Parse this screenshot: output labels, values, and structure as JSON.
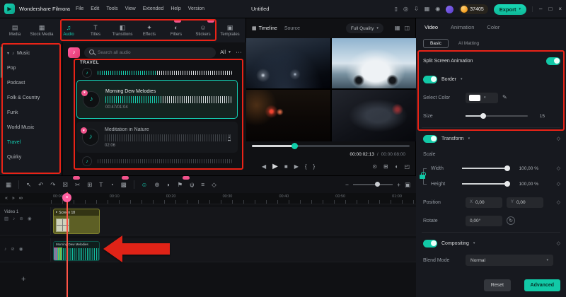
{
  "topbar": {
    "brand": "Wondershare Filmora",
    "menus": [
      "File",
      "Edit",
      "Tools",
      "View",
      "Extended",
      "Help",
      "Version"
    ],
    "project_title": "Untitled",
    "coin_count": "37405",
    "export_label": "Export"
  },
  "media_tabs": [
    {
      "label": "Media",
      "icon": "▤"
    },
    {
      "label": "Stock Media",
      "icon": "▦"
    },
    {
      "label": "Audio",
      "icon": "♫"
    },
    {
      "label": "Titles",
      "icon": "T"
    },
    {
      "label": "Transitions",
      "icon": "◧"
    },
    {
      "label": "Effects",
      "icon": "✦"
    },
    {
      "label": "Filters",
      "icon": "◐"
    },
    {
      "label": "Stickers",
      "icon": "☺"
    },
    {
      "label": "Templates",
      "icon": "▣"
    }
  ],
  "sidebar": {
    "items": [
      "Music",
      "Pop",
      "Podcast",
      "Folk & Country",
      "Funk",
      "World Music",
      "Travel",
      "Quirky"
    ]
  },
  "audio_panel": {
    "search_placeholder": "Search all audio",
    "filter_label": "All",
    "section_title": "TRAVEL",
    "items": [
      {
        "title": "Morning Dew Melodies",
        "time": "00:47/01:04"
      },
      {
        "title": "Meditation in Nature",
        "time": "02:06"
      }
    ]
  },
  "preview": {
    "tab_timeline": "Timeline",
    "tab_source": "Source",
    "quality_label": "Full Quality",
    "timecode_current": "00:00:02:13",
    "timecode_separator": "/",
    "timecode_total": "00:00:08:00"
  },
  "properties": {
    "tab_video": "Video",
    "tab_animation": "Animation",
    "tab_color": "Color",
    "subtab_basic": "Basic",
    "subtab_ai": "AI Matting",
    "split_screen_label": "Split Screen Animation",
    "border_label": "Border",
    "select_color_label": "Select Color",
    "size_label": "Size",
    "size_value": "15",
    "transform_label": "Transform",
    "scale_label": "Scale",
    "width_label": "Width",
    "width_value": "100,00 %",
    "height_label": "Height",
    "height_value": "100,00 %",
    "position_label": "Position",
    "position_x_prefix": "X",
    "position_x_value": "0,00",
    "position_y_prefix": "Y",
    "position_y_value": "0,00",
    "rotate_label": "Rotate",
    "rotate_value": "0,00°",
    "compositing_label": "Compositing",
    "blend_mode_label": "Blend Mode",
    "blend_mode_value": "Normal",
    "reset_label": "Reset",
    "advanced_label": "Advanced"
  },
  "timeline": {
    "ruler_labels": [
      "00:00",
      "00:10",
      "00:20",
      "00:30",
      "00:40",
      "00:50",
      "01:00"
    ],
    "video_track_label": "Video 1",
    "video_clip_label": "Screen 18",
    "audio_clip_label": "Morning Dew Melodies",
    "add_track_label": "+"
  },
  "icons": {
    "logo": "▶",
    "phone": "▯",
    "bell": "◎",
    "import": "⇩",
    "workspace": "▦",
    "record": "◉",
    "caret_down": "▾",
    "minimize": "–",
    "maximize": "□",
    "close": "×",
    "music_note": "♪",
    "heart": "♥",
    "filter": "▼",
    "more": "⋯",
    "download": "↓",
    "timeline_tab": "▦",
    "grid_view": "▦",
    "split_view": "◫",
    "skip_back": "◀",
    "play": "▶",
    "stop": "■",
    "skip_forward": "▶",
    "mark_in": "{",
    "mark_out": "}",
    "snapshot": "⊙",
    "crop": "⊞",
    "speaker": "◖",
    "fullscreen": "◰",
    "layout": "▦",
    "pointer": "↖",
    "undo": "↶",
    "redo": "↷",
    "delete": "☒",
    "split": "✂",
    "text": "T",
    "speed": "◔",
    "mosaic": "▩",
    "ai_face": "☺",
    "motion_track": "⊕",
    "mask": "◗",
    "marker": "⚑",
    "voiceover": "ψ",
    "mixer": "≡",
    "keyframe": "◇",
    "zoom_out": "−",
    "zoom_in": "+",
    "fit": "▣",
    "collapse_left": "«",
    "collapse_right": "»",
    "link": "∞",
    "track_thumb": "▥",
    "track_mute": "♪",
    "track_lock": "⊘",
    "track_eye": "◉",
    "rotate": "↻",
    "eyedropper": "✎",
    "clip_play": "▸"
  },
  "colors": {
    "accent": "#12c9a7",
    "annotation": "#e8291d"
  }
}
